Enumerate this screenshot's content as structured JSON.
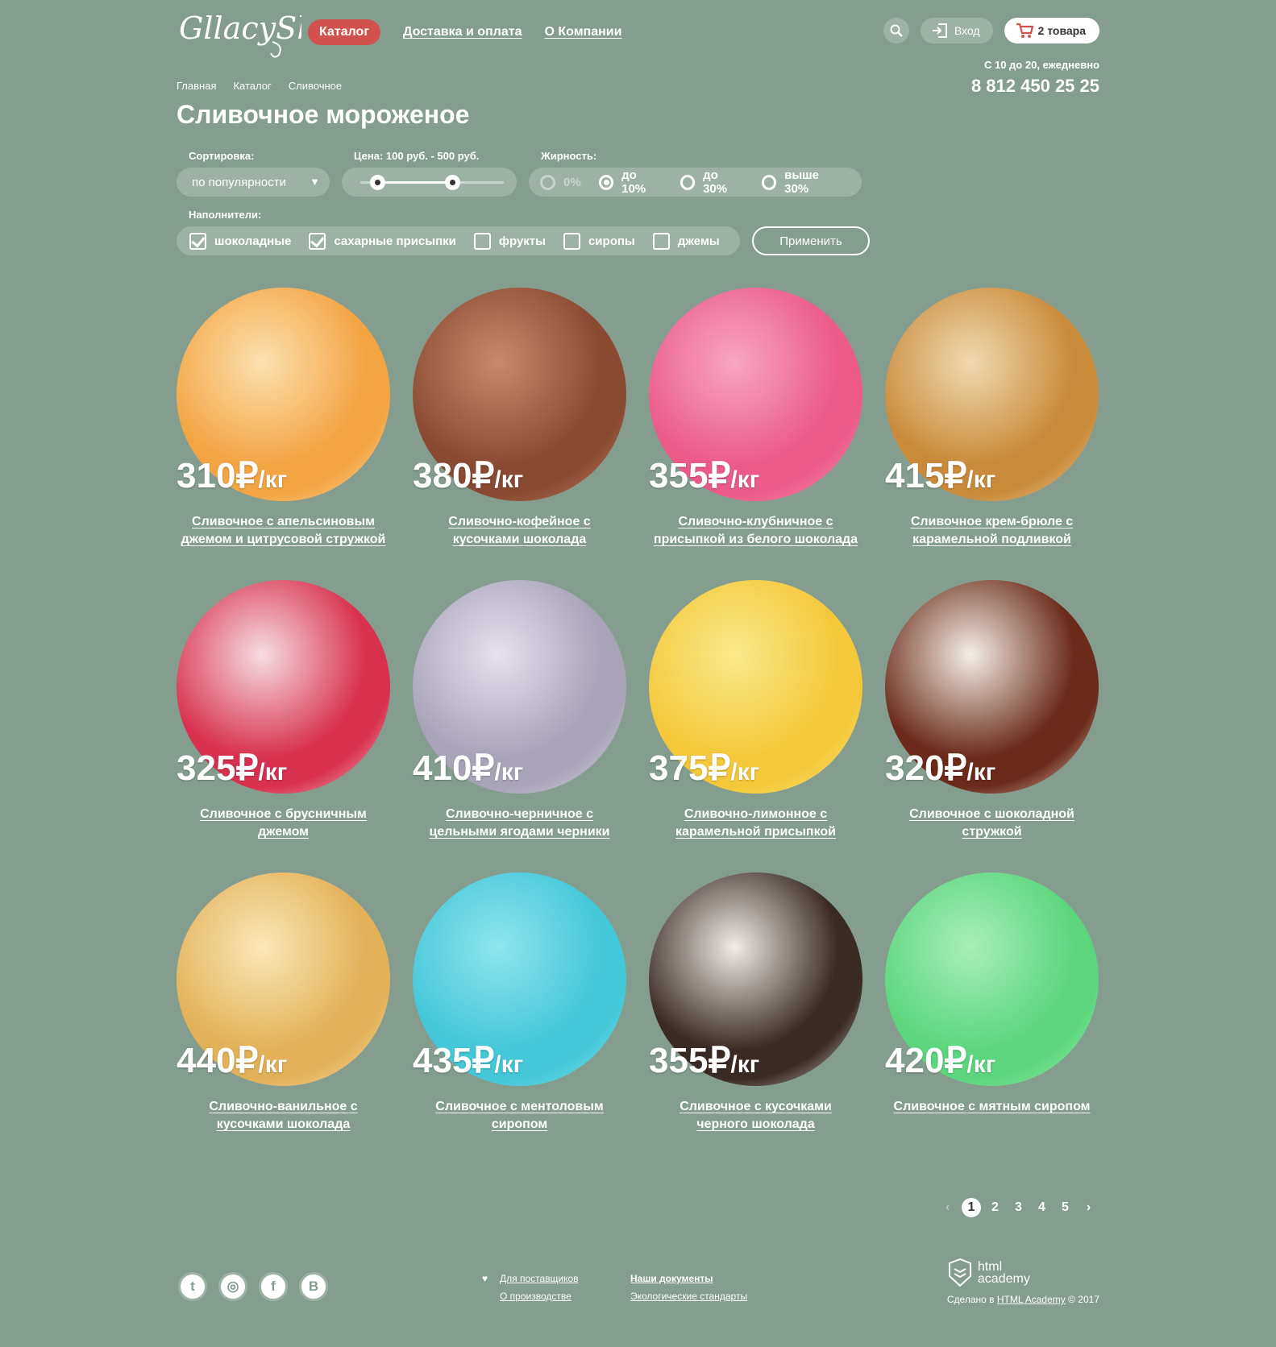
{
  "header": {
    "logo_text": "GllacyShop",
    "nav": [
      "Каталог",
      "Доставка и оплата",
      "О Компании"
    ],
    "login_label": "Вход",
    "cart_label": "2 товара",
    "hours": "С 10 до 20, ежедневно",
    "phone": "8 812 450 25 25"
  },
  "breadcrumbs": [
    "Главная",
    "Каталог",
    "Сливочное"
  ],
  "page_title": "Сливочное мороженое",
  "filters": {
    "sort_label": "Сортировка:",
    "sort_value": "по популярности",
    "price_label": "Цена: 100 руб. - 500 руб.",
    "price_min_fraction": 0.12,
    "price_max_fraction": 0.64,
    "fat_label": "Жирность:",
    "fat_options": [
      {
        "label": "0%",
        "state": "disabled"
      },
      {
        "label": "до 10%",
        "state": "selected"
      },
      {
        "label": "до 30%",
        "state": "off"
      },
      {
        "label": "выше 30%",
        "state": "off"
      }
    ],
    "fillings_label": "Наполнители:",
    "fillings": [
      {
        "label": "шоколадные",
        "checked": true
      },
      {
        "label": "сахарные присыпки",
        "checked": true
      },
      {
        "label": "фрукты",
        "checked": false
      },
      {
        "label": "сиропы",
        "checked": false
      },
      {
        "label": "джемы",
        "checked": false
      }
    ],
    "apply_label": "Применить"
  },
  "products": [
    {
      "price": "310₽",
      "unit": "/кг",
      "name": "Сливочное с апельсиновым джемом и цитрусовой стружкой",
      "color": "#f3a543",
      "color2": "#fde0b0"
    },
    {
      "price": "380₽",
      "unit": "/кг",
      "name": "Сливочно-кофейное с кусочками шоколада",
      "color": "#8a4a32",
      "color2": "#c88a6a"
    },
    {
      "price": "355₽",
      "unit": "/кг",
      "name": "Сливочно-клубничное с присыпкой из белого шоколада",
      "color": "#ec5a8a",
      "color2": "#f7a7c3"
    },
    {
      "price": "415₽",
      "unit": "/кг",
      "name": "Сливочное крем-брюле с карамельной подливкой",
      "color": "#c98a3a",
      "color2": "#f1d9b0"
    },
    {
      "price": "325₽",
      "unit": "/кг",
      "name": "Сливочное с брусничным джемом",
      "color": "#d8314f",
      "color2": "#f6dde2"
    },
    {
      "price": "410₽",
      "unit": "/кг",
      "name": "Сливочно-черничное с цельными ягодами черники",
      "color": "#a9a3b8",
      "color2": "#e6e1ee"
    },
    {
      "price": "375₽",
      "unit": "/кг",
      "name": "Сливочно-лимонное с карамельной присыпкой",
      "color": "#f4c83a",
      "color2": "#fbe98a"
    },
    {
      "price": "320₽",
      "unit": "/кг",
      "name": "Сливочное с шоколадной стружкой",
      "color": "#6b2a1a",
      "color2": "#f4efe8"
    },
    {
      "price": "440₽",
      "unit": "/кг",
      "name": "Сливочно-ванильное с кусочками шоколада",
      "color": "#e3b158",
      "color2": "#fbe7b8"
    },
    {
      "price": "435₽",
      "unit": "/кг",
      "name": "Сливочное с ментоловым сиропом",
      "color": "#43c7d9",
      "color2": "#8fe4ef"
    },
    {
      "price": "355₽",
      "unit": "/кг",
      "name": "Сливочное с кусочками черного шоколада",
      "color": "#3a2a24",
      "color2": "#f1ece6"
    },
    {
      "price": "420₽",
      "unit": "/кг",
      "name": "Сливочное с мятным сиропом",
      "color": "#5cd67d",
      "color2": "#a8eeb8"
    }
  ],
  "pagination": {
    "prev": "‹",
    "pages": [
      "1",
      "2",
      "3",
      "4",
      "5"
    ],
    "current": "1",
    "next": "›"
  },
  "footer": {
    "social": [
      {
        "icon": "twitter-icon",
        "glyph": "t"
      },
      {
        "icon": "instagram-icon",
        "glyph": "◎"
      },
      {
        "icon": "facebook-icon",
        "glyph": "f"
      },
      {
        "icon": "vkontakte-icon",
        "glyph": "B"
      }
    ],
    "links_col1": [
      "Для поставщиков",
      "О производстве"
    ],
    "links_col2": [
      "Наши документы",
      "Экологические стандарты"
    ],
    "academy_logo": [
      "html",
      "academy"
    ],
    "made_in_prefix": "Сделано в ",
    "made_in_link": "HTML Academy",
    "made_in_suffix": " © 2017"
  }
}
